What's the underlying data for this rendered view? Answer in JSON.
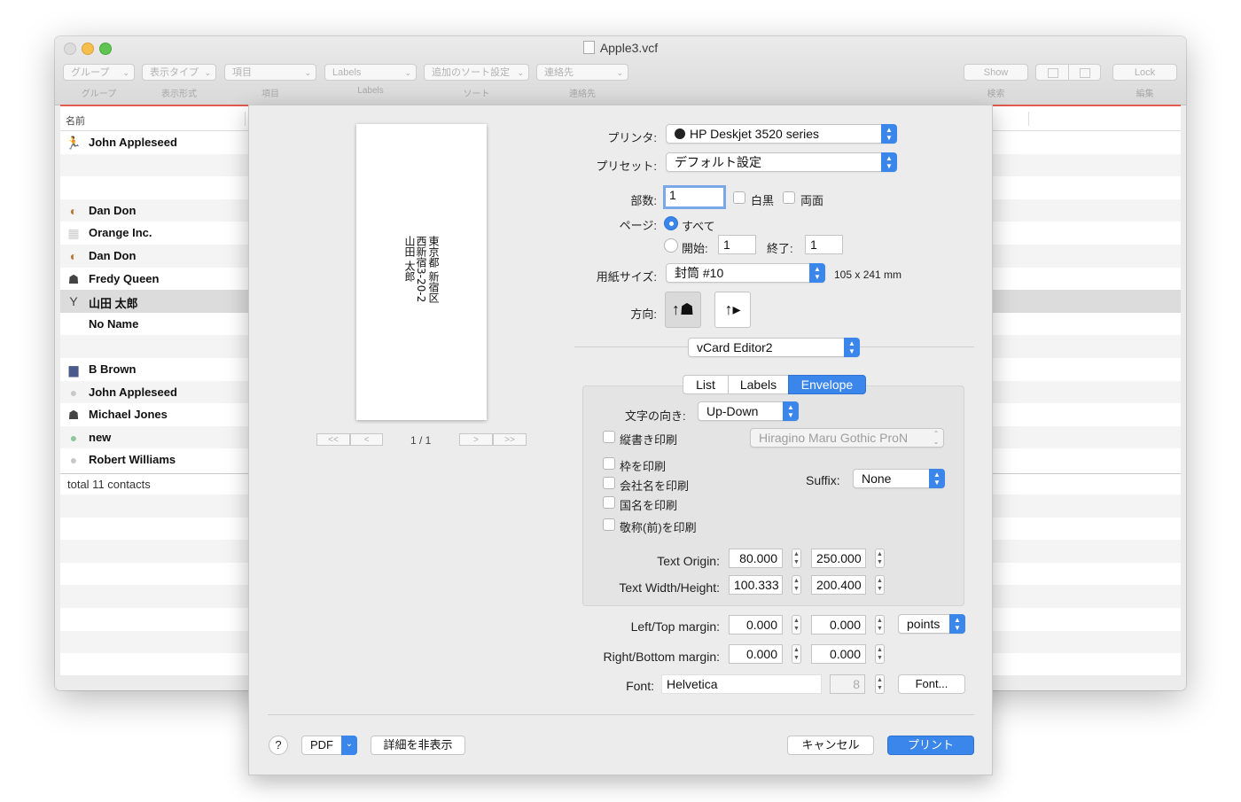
{
  "window": {
    "title": "Apple3.vcf",
    "toolbar": {
      "popups": [
        "グループ",
        "表示タイプ",
        "項目",
        "Labels",
        "追加のソート設定",
        "連絡先"
      ],
      "captions": [
        "グループ",
        "表示形式",
        "項目",
        "Labels",
        "ソート",
        "連絡先",
        "検索",
        "編集"
      ],
      "show_label": "Show",
      "lock_label": "Lock"
    },
    "list": {
      "header": "名前",
      "contacts": [
        {
          "name": "John Appleseed",
          "icon": "runner-icon"
        },
        {
          "name": "",
          "icon": ""
        },
        {
          "name": "",
          "icon": ""
        },
        {
          "name": "Dan Don",
          "icon": "fortune-cookie-icon"
        },
        {
          "name": "Orange Inc.",
          "icon": "building-icon"
        },
        {
          "name": "Dan Don",
          "icon": "fortune-cookie-icon"
        },
        {
          "name": "Fredy Queen",
          "icon": "silhouette-icon"
        },
        {
          "name": "山田 太郎",
          "icon": "figure-icon"
        },
        {
          "name": "No Name",
          "icon": "blank-icon"
        },
        {
          "name": "",
          "icon": ""
        },
        {
          "name": "B Brown",
          "icon": "photo-icon"
        },
        {
          "name": "John Appleseed",
          "icon": "person-gray-icon"
        },
        {
          "name": "Michael Jones",
          "icon": "silhouette-icon"
        },
        {
          "name": "new",
          "icon": "person-green-icon"
        },
        {
          "name": "Robert Williams",
          "icon": "person-gray-icon"
        }
      ],
      "selected_index": 7,
      "footer": "total 11 contacts"
    }
  },
  "print": {
    "preview": {
      "address_lines": [
        "東京都 新宿区",
        "西新宿3-20-2",
        "山田 太郎"
      ],
      "page_indicator": "1 / 1",
      "nav": [
        "<<",
        "<",
        ">",
        ">>"
      ]
    },
    "printer_label": "プリンタ:",
    "printer_value": "HP Deskjet 3520 series",
    "preset_label": "プリセット:",
    "preset_value": "デフォルト設定",
    "copies_label": "部数:",
    "copies_value": "1",
    "bw_label": "白黒",
    "duplex_label": "両面",
    "pages_label": "ページ:",
    "pages_all": "すべて",
    "pages_from_label": "開始:",
    "pages_from": "1",
    "pages_to_label": "終了:",
    "pages_to": "1",
    "paper_label": "用紙サイズ:",
    "paper_value": "封筒 #10",
    "paper_dims": "105 x 241 mm",
    "orientation_label": "方向:",
    "app_popup": "vCard Editor2",
    "tabs": [
      "List",
      "Labels",
      "Envelope"
    ],
    "active_tab": "Envelope",
    "envelope": {
      "direction_label": "文字の向き:",
      "direction_value": "Up-Down",
      "vertical_label": "縦書き印刷",
      "font_popup": "Hiragino Maru Gothic ProN",
      "frame_label": "枠を印刷",
      "company_label": "会社名を印刷",
      "country_label": "国名を印刷",
      "honorific_label": "敬称(前)を印刷",
      "suffix_label": "Suffix:",
      "suffix_value": "None",
      "origin_label": "Text Origin:",
      "origin_x": "80.000",
      "origin_y": "250.000",
      "wh_label": "Text Width/Height:",
      "width": "100.333",
      "height": "200.400"
    },
    "lt_margin_label": "Left/Top margin:",
    "lt_left": "0.000",
    "lt_top": "0.000",
    "units_value": "points",
    "rb_margin_label": "Right/Bottom margin:",
    "rb_right": "0.000",
    "rb_bottom": "0.000",
    "font_label": "Font:",
    "font_value": "Helvetica",
    "font_size": "8",
    "font_button": "Font...",
    "help": "?",
    "pdf_label": "PDF",
    "hide_details": "詳細を非表示",
    "cancel": "キャンセル",
    "print": "プリント"
  }
}
